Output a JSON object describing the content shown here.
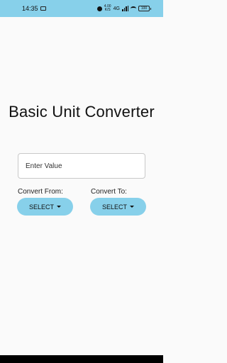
{
  "status_bar": {
    "time": "14:35",
    "net_speed": "4.00 K/S",
    "signal_label": "4G",
    "battery": "100"
  },
  "main": {
    "title": "Basic Unit Converter",
    "input": {
      "placeholder": "Enter Value",
      "value": ""
    },
    "convert_from": {
      "label": "Convert From:",
      "selected": "SELECT"
    },
    "convert_to": {
      "label": "Convert To:",
      "selected": "SELECT"
    }
  },
  "colors": {
    "accent": "#87d0ea",
    "background": "#fafafa"
  }
}
